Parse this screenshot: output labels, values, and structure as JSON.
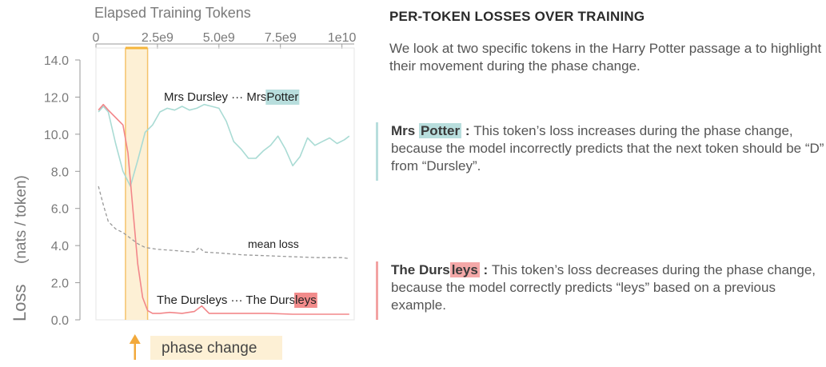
{
  "panel": {
    "title": "PER-TOKEN LOSSES OVER TRAINING",
    "intro": "We look at two specific tokens in the Harry Potter passage a to highlight their movement during the phase change."
  },
  "notes": {
    "potter": {
      "prefix": "Mrs ",
      "highlight": "Potter",
      "sep": " : ",
      "text": "This token’s loss increases during the phase change, because the model incorrectly predicts that the next token should be “D” from “Dursley”."
    },
    "dursleys": {
      "prefix": "The Durs",
      "highlight": "leys",
      "sep": " : ",
      "text": "This token’s loss decreases during the phase change, because the model correctly predicts “leys” based on a previous example."
    }
  },
  "chart_data": {
    "type": "line",
    "xlabel": "Elapsed Training Tokens",
    "ylabel_main": "Loss",
    "ylabel_sub": "(nats / token)",
    "xlim": [
      0,
      10500000000
    ],
    "ylim": [
      0,
      14
    ],
    "x_ticks": [
      0,
      2500000000,
      5000000000,
      7500000000,
      10000000000
    ],
    "x_tick_labels": [
      "0",
      "2.5e9",
      "5.0e9",
      "7.5e9",
      "1e10"
    ],
    "y_ticks": [
      0,
      2,
      4,
      6,
      8,
      10,
      12,
      14
    ],
    "y_tick_labels": [
      "0.0",
      "2.0",
      "4.0",
      "6.0",
      "8.0",
      "10.0",
      "12.0",
      "14.0"
    ],
    "phase_change": {
      "start": 1200000000,
      "end": 2100000000,
      "label": "phase change",
      "color": "#fdf0d5",
      "line_color": "#f5c36b"
    },
    "series": [
      {
        "key": "potter",
        "color": "#a9dbd4",
        "label_prefix": "Mrs Dursley ··· Mrs ",
        "label_highlight": "Potter",
        "highlight_color": "#b8dedd",
        "x": [
          100000000,
          300000000,
          500000000,
          800000000,
          1100000000,
          1400000000,
          1700000000,
          2000000000,
          2300000000,
          2600000000,
          2900000000,
          3200000000,
          3500000000,
          3800000000,
          4100000000,
          4400000000,
          4700000000,
          5000000000,
          5300000000,
          5600000000,
          5900000000,
          6200000000,
          6500000000,
          6800000000,
          7100000000,
          7400000000,
          7700000000,
          8000000000,
          8300000000,
          8600000000,
          8900000000,
          9200000000,
          9500000000,
          9800000000,
          10100000000,
          10300000000
        ],
        "y": [
          11.2,
          11.5,
          11.2,
          9.5,
          8.0,
          7.2,
          8.6,
          10.1,
          10.5,
          11.2,
          11.4,
          11.3,
          11.5,
          11.3,
          11.4,
          11.6,
          11.5,
          11.4,
          10.7,
          9.6,
          9.2,
          8.7,
          8.7,
          9.1,
          9.4,
          9.9,
          9.2,
          8.3,
          8.8,
          9.8,
          9.4,
          9.6,
          9.8,
          9.5,
          9.7,
          9.9
        ]
      },
      {
        "key": "dursleys",
        "color": "#f2878a",
        "label_prefix": "The Dursleys ··· The Durs",
        "label_highlight": "leys",
        "highlight_color": "#f28b8b",
        "x": [
          100000000,
          300000000,
          500000000,
          800000000,
          1100000000,
          1300000000,
          1500000000,
          1700000000,
          1900000000,
          2100000000,
          2300000000,
          2600000000,
          3000000000,
          3500000000,
          4000000000,
          4300000000,
          4600000000,
          5000000000,
          6000000000,
          7000000000,
          8000000000,
          9000000000,
          10000000000,
          10300000000
        ],
        "y": [
          11.3,
          11.6,
          11.3,
          10.9,
          10.5,
          9.0,
          6.0,
          3.0,
          1.2,
          0.5,
          0.35,
          0.35,
          0.4,
          0.35,
          0.45,
          0.75,
          0.35,
          0.35,
          0.35,
          0.35,
          0.3,
          0.3,
          0.3,
          0.3
        ]
      },
      {
        "key": "mean",
        "color": "#999999",
        "dashed": true,
        "label": "mean loss",
        "x": [
          100000000,
          300000000,
          500000000,
          800000000,
          1100000000,
          1400000000,
          1700000000,
          2000000000,
          2500000000,
          3000000000,
          3500000000,
          4000000000,
          4200000000,
          4400000000,
          5000000000,
          6000000000,
          7000000000,
          8000000000,
          9000000000,
          10000000000,
          10300000000
        ],
        "y": [
          7.2,
          6.2,
          5.3,
          4.9,
          4.7,
          4.4,
          4.1,
          3.9,
          3.8,
          3.75,
          3.7,
          3.65,
          3.9,
          3.65,
          3.6,
          3.5,
          3.45,
          3.4,
          3.35,
          3.35,
          3.3
        ]
      }
    ]
  }
}
